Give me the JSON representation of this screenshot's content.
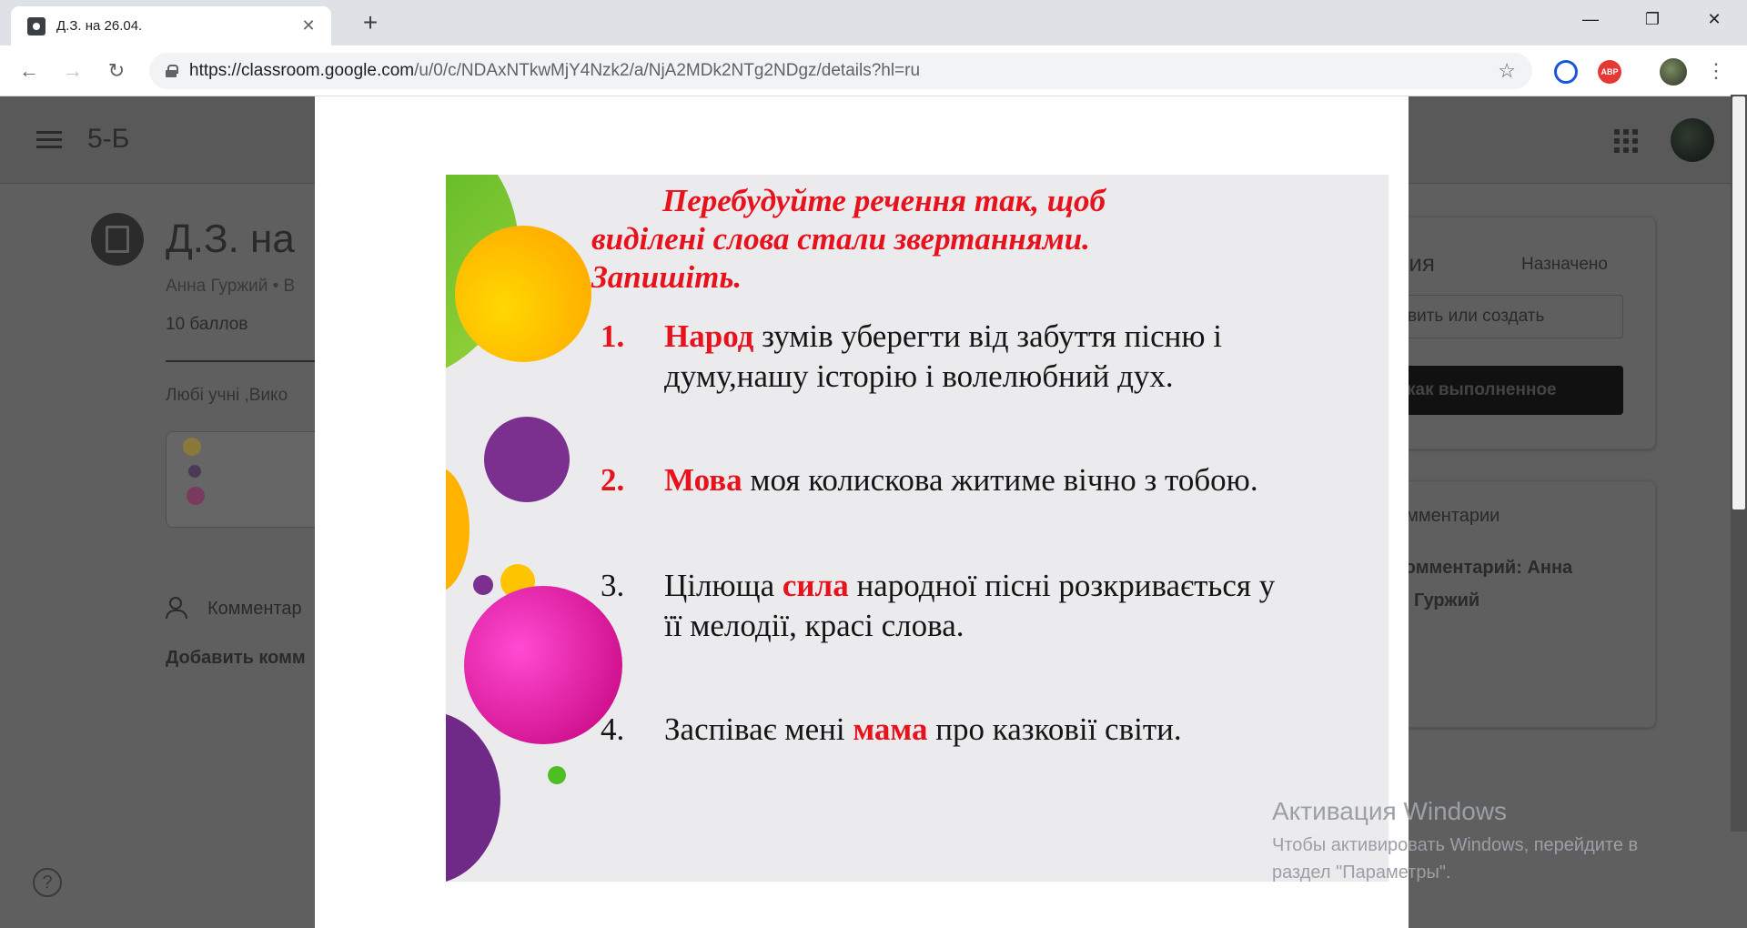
{
  "browser": {
    "tab_title": "Д.З. на 26.04.",
    "url_host": "https://classroom.google.com",
    "url_path": "/u/0/c/NDAxNTkwMjY4Nzk2/a/NjA2MDk2NTg2NDgz/details?hl=ru",
    "ext_abp": "ABP"
  },
  "header": {
    "class_name": "5-Б"
  },
  "assignment": {
    "title": "Д.З. на",
    "meta": "Анна Гуржий • В",
    "points": "10 баллов",
    "description": "Любі учні  ,Вико",
    "comments_label": "Комментар",
    "add_comment": "Добавить комм"
  },
  "side": {
    "my_work_title": "ния",
    "status": "Назначено",
    "add_create": "вить или создать",
    "mark_done": "как выполненное",
    "private_comments": "омментарии",
    "add_private_line1": "комментарий: Анна",
    "add_private_line2": "Гуржий"
  },
  "help_label": "?",
  "slide": {
    "title_line1": "Перебудуйте речення так, щоб",
    "title_line2": "виділені слова стали звертаннями.",
    "title_line3": "Запишіть.",
    "items": [
      {
        "num": "1.",
        "hl": "Народ",
        "rest1": " зумів уберегти від забуття пісню і",
        "rest2": "думу,нашу історію і   волелюбний дух."
      },
      {
        "num": "2.",
        "hl": "Мова",
        "rest1": " моя колискова житиме вічно з тобою."
      },
      {
        "num": "3.",
        "pre": "Цілюща ",
        "hl": "сила",
        "rest1": " народної пісні розкривається у",
        "rest2": "її мелодії, красі слова."
      },
      {
        "num": "4.",
        "pre": "Заспіває мені ",
        "hl": "мама",
        "rest1": " про казковії світи."
      }
    ]
  },
  "watermark": {
    "title": "Активация Windows",
    "text": "Чтобы активировать Windows, перейдите в раздел \"Параметры\"."
  }
}
